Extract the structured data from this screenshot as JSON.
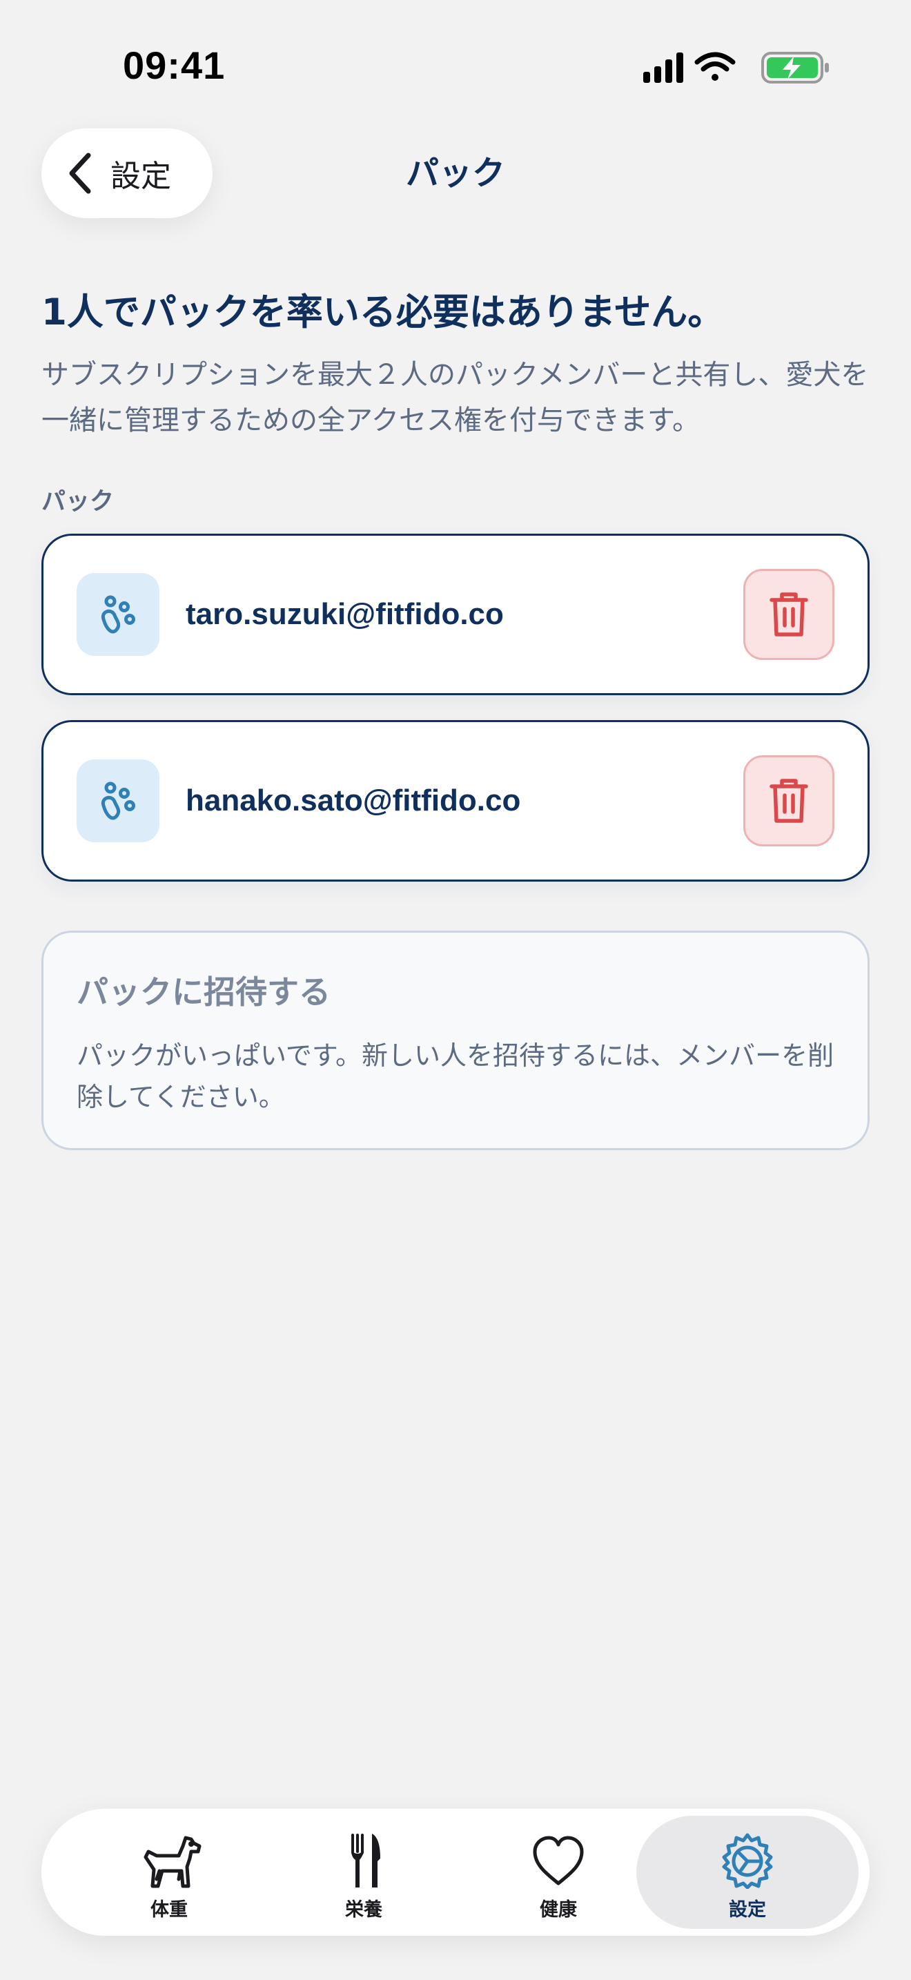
{
  "status_bar": {
    "time": "09:41"
  },
  "nav": {
    "back_label": "設定",
    "title": "パック"
  },
  "intro": {
    "headline": "1人でパックを率いる必要はありません。",
    "description": "サブスクリプションを最大２人のパックメンバーと共有し、愛犬を一緒に管理するための全アクセス権を付与できます。"
  },
  "pack": {
    "section_label": "パック",
    "members": [
      {
        "email": "taro.suzuki@fitfido.co"
      },
      {
        "email": "hanako.sato@fitfido.co"
      }
    ]
  },
  "invite": {
    "title": "パックに招待する",
    "message": "パックがいっぱいです。新しい人を招待するには、メンバーを削除してください。"
  },
  "tabs": [
    {
      "label": "体重",
      "icon": "dog-icon"
    },
    {
      "label": "栄養",
      "icon": "fork-knife-icon"
    },
    {
      "label": "健康",
      "icon": "heart-icon"
    },
    {
      "label": "設定",
      "icon": "gear-icon",
      "active": true
    }
  ],
  "colors": {
    "primary": "#0F2F5C",
    "accent": "#2F80B7",
    "danger": "#D9484B",
    "danger_bg": "#FCE3E3",
    "background": "#F2F2F3",
    "battery": "#34C759"
  }
}
